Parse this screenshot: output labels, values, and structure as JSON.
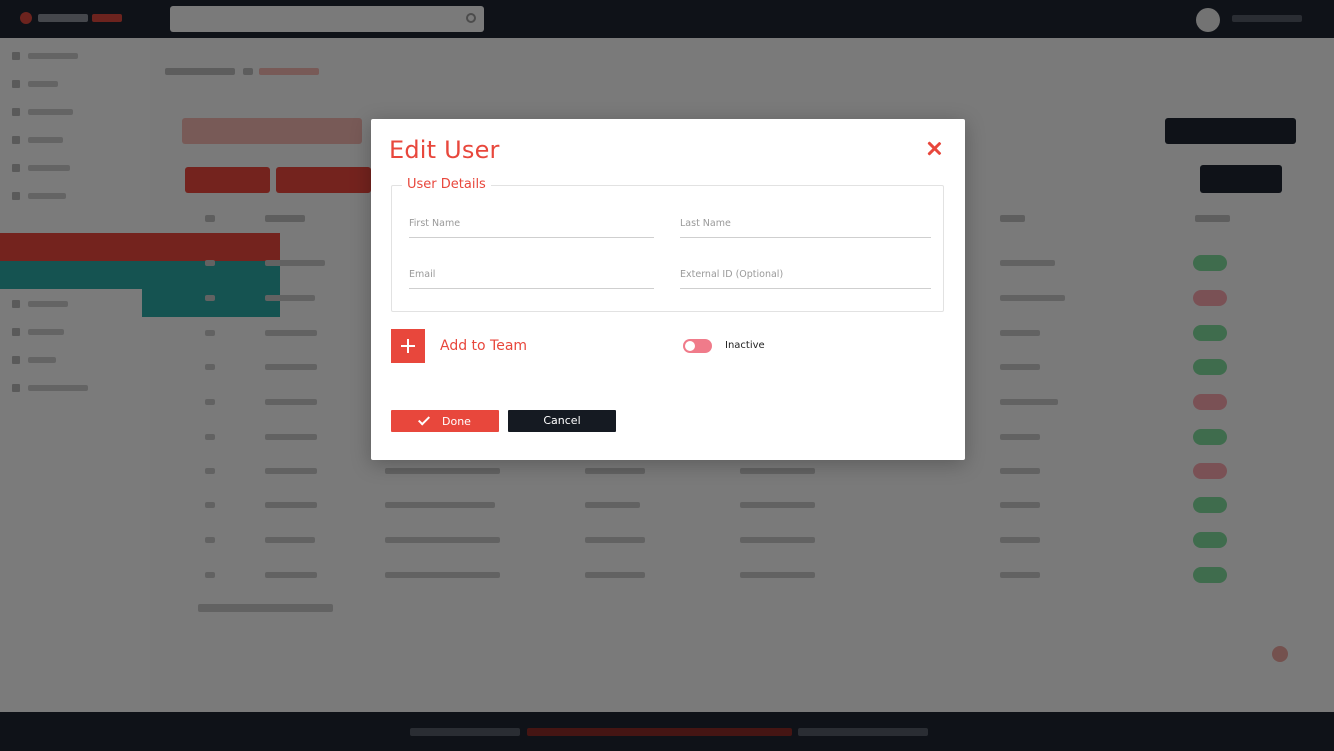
{
  "modal": {
    "title": "Edit User",
    "fieldset_legend": "User Details",
    "fields": {
      "first_name": {
        "value": "",
        "placeholder": "First Name"
      },
      "last_name": {
        "value": "",
        "placeholder": "Last Name"
      },
      "email": {
        "value": "",
        "placeholder": "Email"
      },
      "external_id": {
        "value": "",
        "placeholder": "External ID (Optional)"
      }
    },
    "add_to_team_label": "Add to Team",
    "status_toggle": {
      "label": "Inactive",
      "state": "off"
    },
    "done_label": "Done",
    "cancel_label": "Cancel"
  },
  "colors": {
    "accent": "#e8473c",
    "dark": "#1e2430",
    "toggle": "#f07b8a"
  },
  "icons": [
    "close-icon",
    "plus-icon",
    "check-icon",
    "search-icon",
    "avatar-icon"
  ]
}
